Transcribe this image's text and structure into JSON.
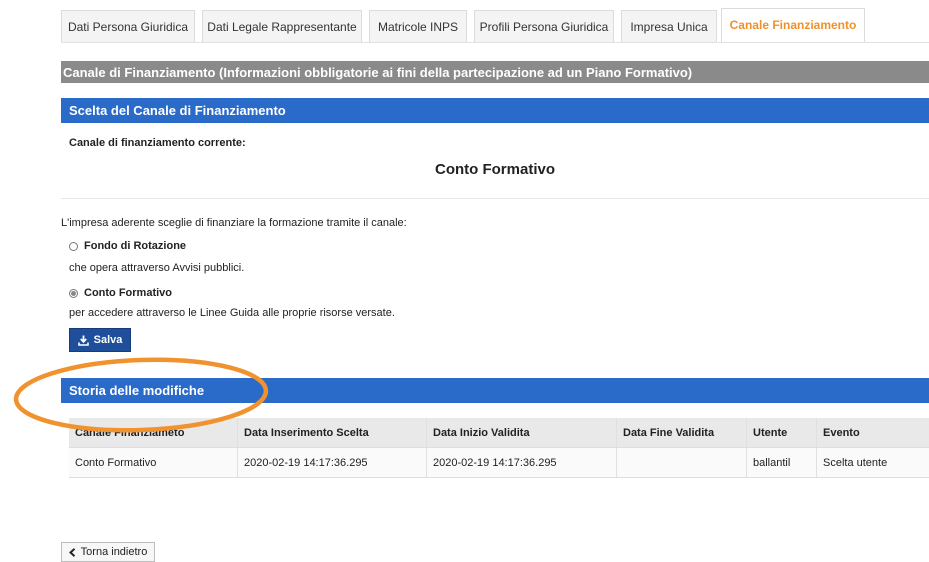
{
  "tabs": [
    {
      "label": "Dati Persona Giuridica",
      "active": false
    },
    {
      "label": "Dati Legale Rappresentante",
      "active": false
    },
    {
      "label": "Matricole INPS",
      "active": false
    },
    {
      "label": "Profili Persona Giuridica",
      "active": false
    },
    {
      "label": "Impresa Unica",
      "active": false
    },
    {
      "label": "Canale Finanziamento",
      "active": true
    }
  ],
  "main_header": "Canale di Finanziamento (Informazioni obbligatorie ai fini della partecipazione ad un Piano Formativo)",
  "choice_section": {
    "title": "Scelta del Canale di Finanziamento",
    "current_label": "Canale di finanziamento corrente:",
    "current_value": "Conto Formativo"
  },
  "intro_text": "L'impresa aderente sceglie di finanziare la formazione tramite il canale:",
  "options": [
    {
      "label": "Fondo di Rotazione",
      "description": "che opera attraverso Avvisi pubblici.",
      "selected": false
    },
    {
      "label": "Conto Formativo",
      "description": "per accedere attraverso le Linee Guida alle proprie risorse versate.",
      "selected": true
    }
  ],
  "save_button": {
    "label": "Salva",
    "icon": "download-icon"
  },
  "history_section": {
    "title": "Storia delle modifiche",
    "columns": [
      "Canale Finanziameto",
      "Data Inserimento Scelta",
      "Data Inizio Validita",
      "Data Fine Validita",
      "Utente",
      "Evento"
    ],
    "rows": [
      [
        "Conto Formativo",
        "2020-02-19 14:17:36.295",
        "2020-02-19 14:17:36.295",
        "",
        "ballantil",
        "Scelta utente"
      ]
    ]
  },
  "back_button": {
    "label": "Torna indietro",
    "icon": "chevron-left-icon"
  },
  "colors": {
    "accent_tab": "#f0902a",
    "section_blue": "#2a6ac8",
    "section_gray": "#8a8a8a",
    "button_dark": "#1f4f9a",
    "annotation": "#f0922e"
  }
}
